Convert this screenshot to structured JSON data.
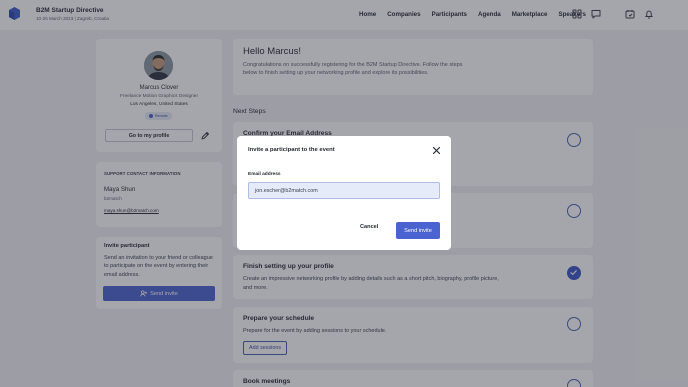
{
  "header": {
    "event_title": "B2M Startup Directive",
    "event_subtitle": "10-25 March 2023 | Zagreb, Croatia",
    "nav": [
      "Home",
      "Companies",
      "Participants",
      "Agenda",
      "Marketplace",
      "Speakers"
    ],
    "icons": [
      "grid-icon",
      "chat-icon",
      "calendar-icon",
      "bell-icon"
    ]
  },
  "profile": {
    "name": "Marcus Clover",
    "job_title": "Freelance Motion Graphics Designer",
    "location": "Los Angeles, United States",
    "badge": "Remote",
    "profile_button": "Go to my profile"
  },
  "support": {
    "heading": "SUPPORT CONTACT INFORMATION",
    "contact_name": "Maya Shun",
    "organization": "b2match",
    "email": "maya.shun@b2match.com"
  },
  "invite": {
    "title": "Invite participant",
    "text": "Send an invitation to your friend or colleague to participate on the event by entering their email address.",
    "button": "Send invite"
  },
  "welcome": {
    "title": "Hello Marcus!",
    "text": "Congratulations on successfully registering for the B2M Startup Directive. Follow the steps below to finish setting up your networking profile and explore its possibilities."
  },
  "next_steps_heading": "Next Steps",
  "steps": [
    {
      "title": "Confirm your Email Address",
      "description": "",
      "button": "",
      "done": false
    },
    {
      "title": "",
      "description": "",
      "button": "",
      "done": false
    },
    {
      "title": "Finish setting up your profile",
      "description": "Create an impressive networking profile by adding details such as a short pitch, biography, profile picture, and more.",
      "button": "",
      "done": true
    },
    {
      "title": "Prepare your schedule",
      "description": "Prepare for the event by adding sessions to your schedule.",
      "button": "Add sessions",
      "done": false
    },
    {
      "title": "Book meetings",
      "description": "",
      "button": "",
      "done": false
    }
  ],
  "modal": {
    "title": "Invite a participant to the event",
    "email_label": "Email address",
    "email_value": "jon.escher@b2match.com",
    "cancel": "Cancel",
    "send": "Send invite"
  },
  "colors": {
    "primary": "#4a63d0",
    "background": "#f1f2f5",
    "overlay": "rgba(40,44,54,0.42)"
  }
}
